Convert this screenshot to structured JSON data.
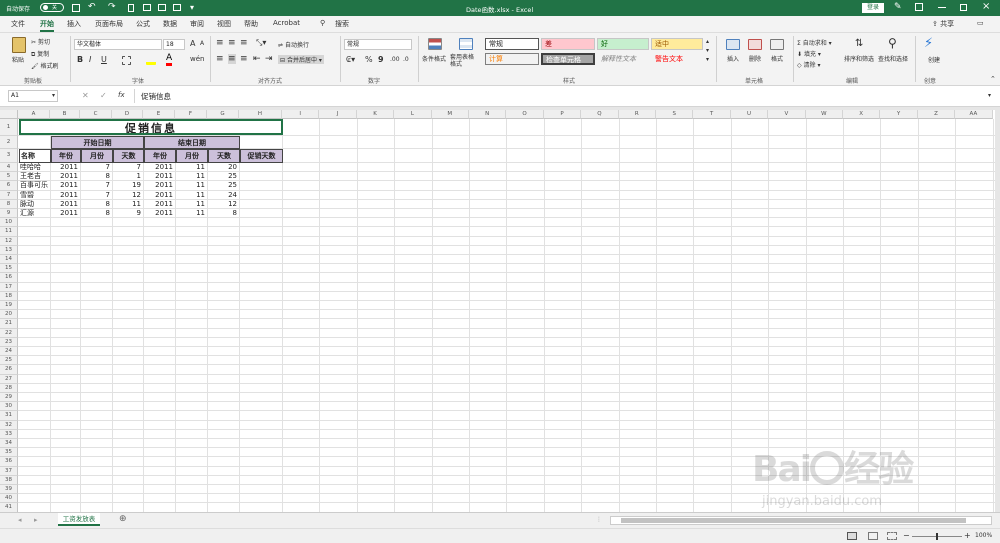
{
  "titlebar": {
    "autosave_label": "自动保存",
    "autosave_state": "关",
    "doc_title": "Date函数.xlsx - Excel",
    "login_button": "登录"
  },
  "ribbon_tabs": [
    "文件",
    "开始",
    "插入",
    "页面布局",
    "公式",
    "数据",
    "审阅",
    "视图",
    "帮助",
    "Acrobat"
  ],
  "active_tab": "开始",
  "search_label": "搜索",
  "share_label": "共享",
  "ribbon": {
    "clipboard": {
      "paste": "粘贴",
      "cut": "剪切",
      "copy": "复制",
      "format_painter": "格式刷",
      "label": "剪贴板"
    },
    "font": {
      "name": "华文楷体",
      "size": "18",
      "bold": "B",
      "italic": "I",
      "underline": "U",
      "grow": "A",
      "shrink": "A",
      "label": "字体"
    },
    "alignment": {
      "wrap": "自动换行",
      "merge": "合并后居中",
      "label": "对齐方式"
    },
    "number": {
      "format": "常规",
      "percent": "%",
      "comma": "9",
      "label": "数字"
    },
    "styles": {
      "conditional": "条件格式",
      "table_format": "套用表格格式",
      "cells": [
        "常规",
        "差",
        "好",
        "适中",
        "计算",
        "检查单元格",
        "解释性文本",
        "警告文本"
      ],
      "label": "样式"
    },
    "cells_group": {
      "insert": "插入",
      "delete": "删除",
      "format": "格式",
      "label": "单元格"
    },
    "editing": {
      "autosum": "自动求和",
      "fill": "填充",
      "clear": "清除",
      "sort": "排序和筛选",
      "find": "查找和选择",
      "label": "编辑"
    },
    "create": {
      "create": "创建",
      "label": "创意"
    }
  },
  "formula_bar": {
    "name_box": "A1",
    "fx": "fx",
    "content": "促销信息"
  },
  "columns": [
    "A",
    "B",
    "C",
    "D",
    "E",
    "F",
    "G",
    "H",
    "I",
    "J",
    "K",
    "L",
    "M",
    "N",
    "O",
    "P",
    "Q",
    "R",
    "S",
    "T",
    "U",
    "V",
    "W",
    "X",
    "Y",
    "Z",
    "AA"
  ],
  "sheet": {
    "title": "促销信息",
    "start_date": "开始日期",
    "end_date": "结束日期",
    "headers": [
      "名称",
      "年份",
      "月份",
      "天数",
      "年份",
      "月份",
      "天数",
      "促销天数"
    ],
    "rows": [
      [
        "哇哈哈",
        "2011",
        "7",
        "7",
        "2011",
        "11",
        "20"
      ],
      [
        "王老吉",
        "2011",
        "8",
        "1",
        "2011",
        "11",
        "25"
      ],
      [
        "百事可乐",
        "2011",
        "7",
        "19",
        "2011",
        "11",
        "25"
      ],
      [
        "雪碧",
        "2011",
        "7",
        "12",
        "2011",
        "11",
        "24"
      ],
      [
        "脉动",
        "2011",
        "8",
        "11",
        "2011",
        "11",
        "12"
      ],
      [
        "汇源",
        "2011",
        "8",
        "9",
        "2011",
        "11",
        "8"
      ]
    ]
  },
  "sheet_tab": "工资发放表",
  "zoom": "100%",
  "watermark": {
    "brand": "Baidu经验",
    "url": "jingyan.baidu.com"
  },
  "colors": {
    "excel_green": "#217346",
    "header_fill": "#ccc0da",
    "bad": "#ffc7ce",
    "good": "#c6efce",
    "neutral": "#ffeb9c"
  }
}
